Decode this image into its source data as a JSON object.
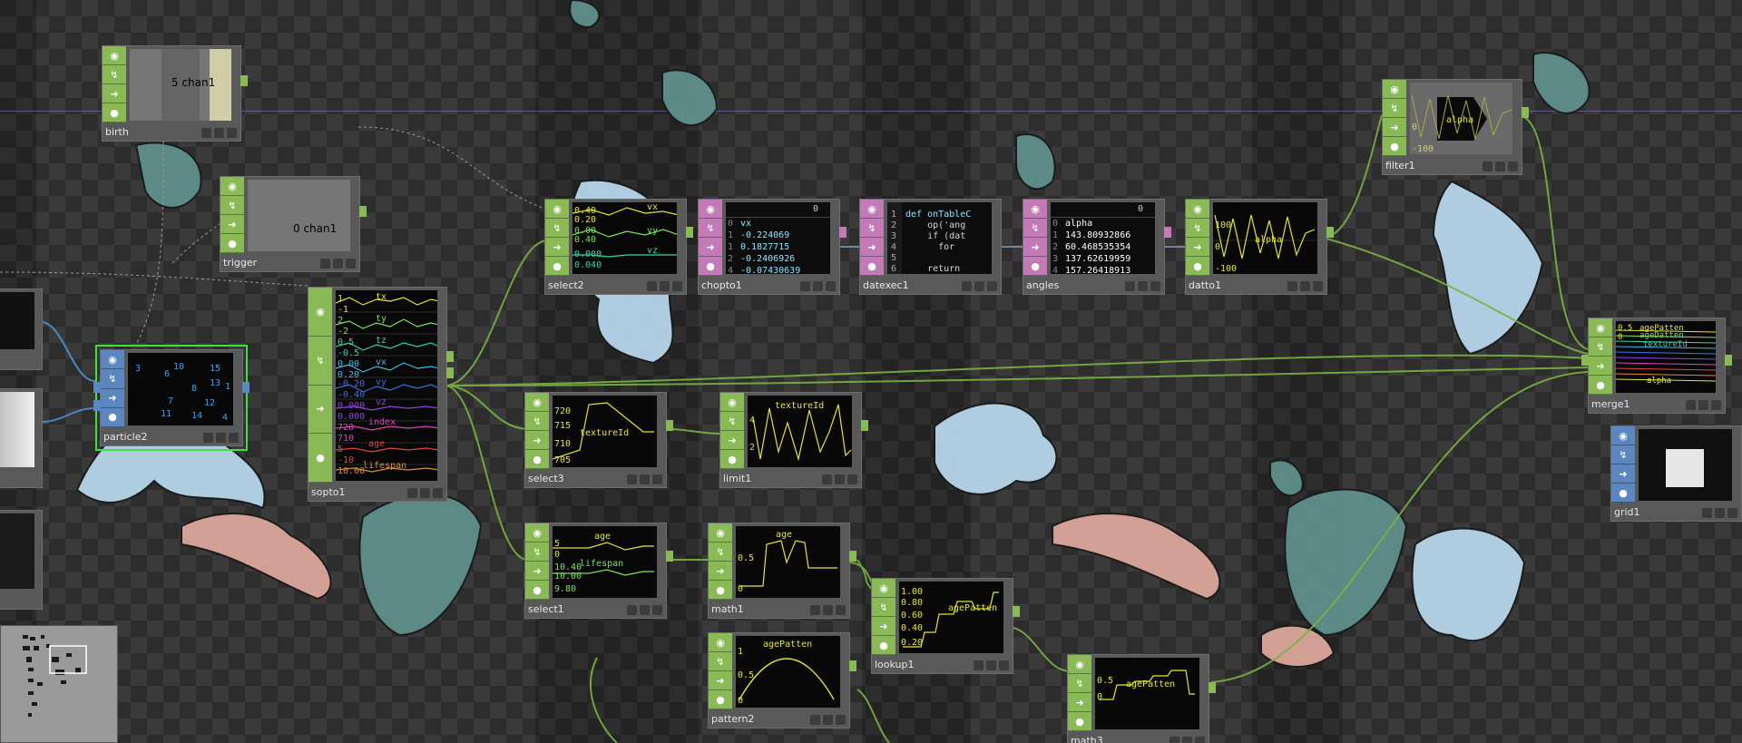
{
  "colors": {
    "chop": "#8aba56",
    "top": "#5b86bf",
    "dat": "#c37bb8",
    "wire": "#79b343",
    "background": "#2d2d2d"
  },
  "nodes": {
    "birth": {
      "name": "birth",
      "value": "5 chan1"
    },
    "trigger": {
      "name": "trigger",
      "value": "0 chan1"
    },
    "particle": {
      "name": "particle2",
      "numbers": [
        "3",
        "10",
        "15",
        "6",
        "13",
        "8",
        "1",
        "7",
        "12",
        "11",
        "14",
        "4"
      ]
    },
    "sopto": {
      "name": "sopto1",
      "channels": [
        "tx",
        "ty",
        "tz",
        "vx",
        "vy",
        "vz",
        "index",
        "age",
        "lifespan"
      ],
      "ticks": [
        "1",
        "-1",
        "2",
        "-2",
        "0.5",
        "-0.5",
        "0.00",
        "0.20",
        "-0.20",
        "0.00",
        "-0.40",
        "0.000",
        "0.000",
        "720",
        "710",
        "5",
        "-10",
        "10.00",
        "0.00"
      ]
    },
    "select2": {
      "name": "select2",
      "channels": [
        "vx",
        "vy",
        "vz"
      ],
      "ticks": [
        "0.40",
        "0.20",
        "0.00",
        "-0.20",
        "0.40",
        "0.000",
        "0.040"
      ]
    },
    "chopto": {
      "name": "chopto1",
      "header": "0",
      "rows": [
        {
          "i": "0",
          "v": "vx"
        },
        {
          "i": "1",
          "v": "-0.224069"
        },
        {
          "i": "1",
          "v": "0.1827715"
        },
        {
          "i": "2",
          "v": "-0.2406926"
        },
        {
          "i": "4",
          "v": "-0.07430639"
        }
      ]
    },
    "datexec": {
      "name": "datexec1",
      "lines": [
        "1",
        "2",
        "3",
        "4",
        "5",
        "6"
      ],
      "code": [
        "def onTableC",
        "    op('ang",
        "    if (dat",
        "      for",
        "",
        "    return"
      ]
    },
    "angles": {
      "name": "angles",
      "header": "0",
      "rows": [
        {
          "i": "0",
          "v": "alpha"
        },
        {
          "i": "1",
          "v": "143.80932866"
        },
        {
          "i": "2",
          "v": "60.468535354"
        },
        {
          "i": "3",
          "v": "137.62619959"
        },
        {
          "i": "4",
          "v": "157.26418913"
        }
      ]
    },
    "datto": {
      "name": "datto1",
      "channel": "alpha",
      "ticks": [
        "100",
        "0",
        "-100"
      ]
    },
    "filter": {
      "name": "filter1",
      "channel": "alpha",
      "ticks": [
        "0",
        "-100"
      ]
    },
    "merge": {
      "name": "merge1",
      "ticks": [
        "0.5",
        "0",
        "0.5",
        "0"
      ],
      "labels": [
        "agePatten",
        "ageDatten",
        "textureId",
        "alpha"
      ]
    },
    "grid": {
      "name": "grid1"
    },
    "select3": {
      "name": "select3",
      "channel": "textureId",
      "ticks": [
        "720",
        "715",
        "710",
        "705"
      ]
    },
    "limit": {
      "name": "limit1",
      "channel": "textureId",
      "ticks": [
        "4",
        "2"
      ]
    },
    "select1": {
      "name": "select1",
      "channels": [
        "age",
        "lifespan"
      ],
      "ticks": [
        "5",
        "0",
        "10.40",
        "10.00",
        "9.80"
      ]
    },
    "math": {
      "name": "math1",
      "channel": "age",
      "ticks": [
        "0.5",
        "0"
      ]
    },
    "lookup": {
      "name": "lookup1",
      "channel": "agePatten",
      "ticks": [
        "1.00",
        "0.80",
        "0.60",
        "0.40",
        "0.20"
      ]
    },
    "pattern": {
      "name": "pattern2",
      "channel": "agePatten",
      "ticks": [
        "1",
        "0.5",
        "0"
      ]
    },
    "math3": {
      "name": "math3",
      "channel": "agePatten",
      "ticks": [
        "0.5",
        "0"
      ]
    }
  }
}
